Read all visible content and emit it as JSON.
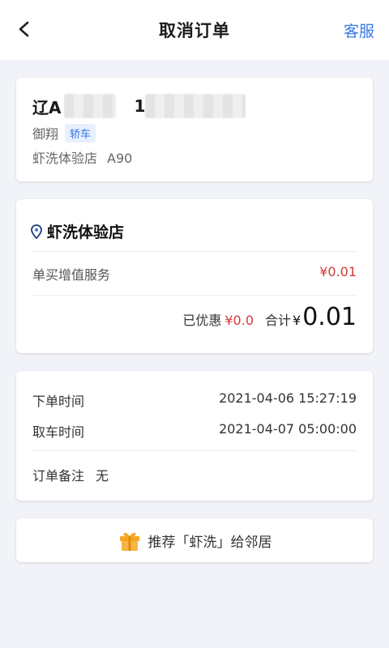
{
  "header": {
    "title": "取消订单",
    "service_label": "客服"
  },
  "vehicle": {
    "plate_prefix": "辽A",
    "plate_suffix_visible": "1",
    "model": "御翔",
    "car_type": "轿车",
    "store_name": "虾洗体验店",
    "store_code": "A90"
  },
  "price_card": {
    "store_name": "虾洗体验店",
    "service_name": "单买增值服务",
    "service_price": "¥0.01",
    "discount_label": "已优惠",
    "discount_value": "¥0.0",
    "total_label": "合计",
    "total_currency": "¥",
    "total_value": "0.01"
  },
  "order_info": {
    "order_time_label": "下单时间",
    "order_time_value": "2021-04-06 15:27:19",
    "pickup_time_label": "取车时间",
    "pickup_time_value": "2021-04-07 05:00:00",
    "note_label": "订单备注",
    "note_value": "无"
  },
  "recommend": {
    "text": "推荐「虾洗」给邻居"
  },
  "colors": {
    "accent": "#3a78e6",
    "price_red": "#d03b3b",
    "gift_orange": "#f5a623",
    "background": "#f1f3f8"
  },
  "icons": {
    "back": "back-arrow-icon",
    "location": "location-pin-icon",
    "gift": "gift-icon"
  }
}
